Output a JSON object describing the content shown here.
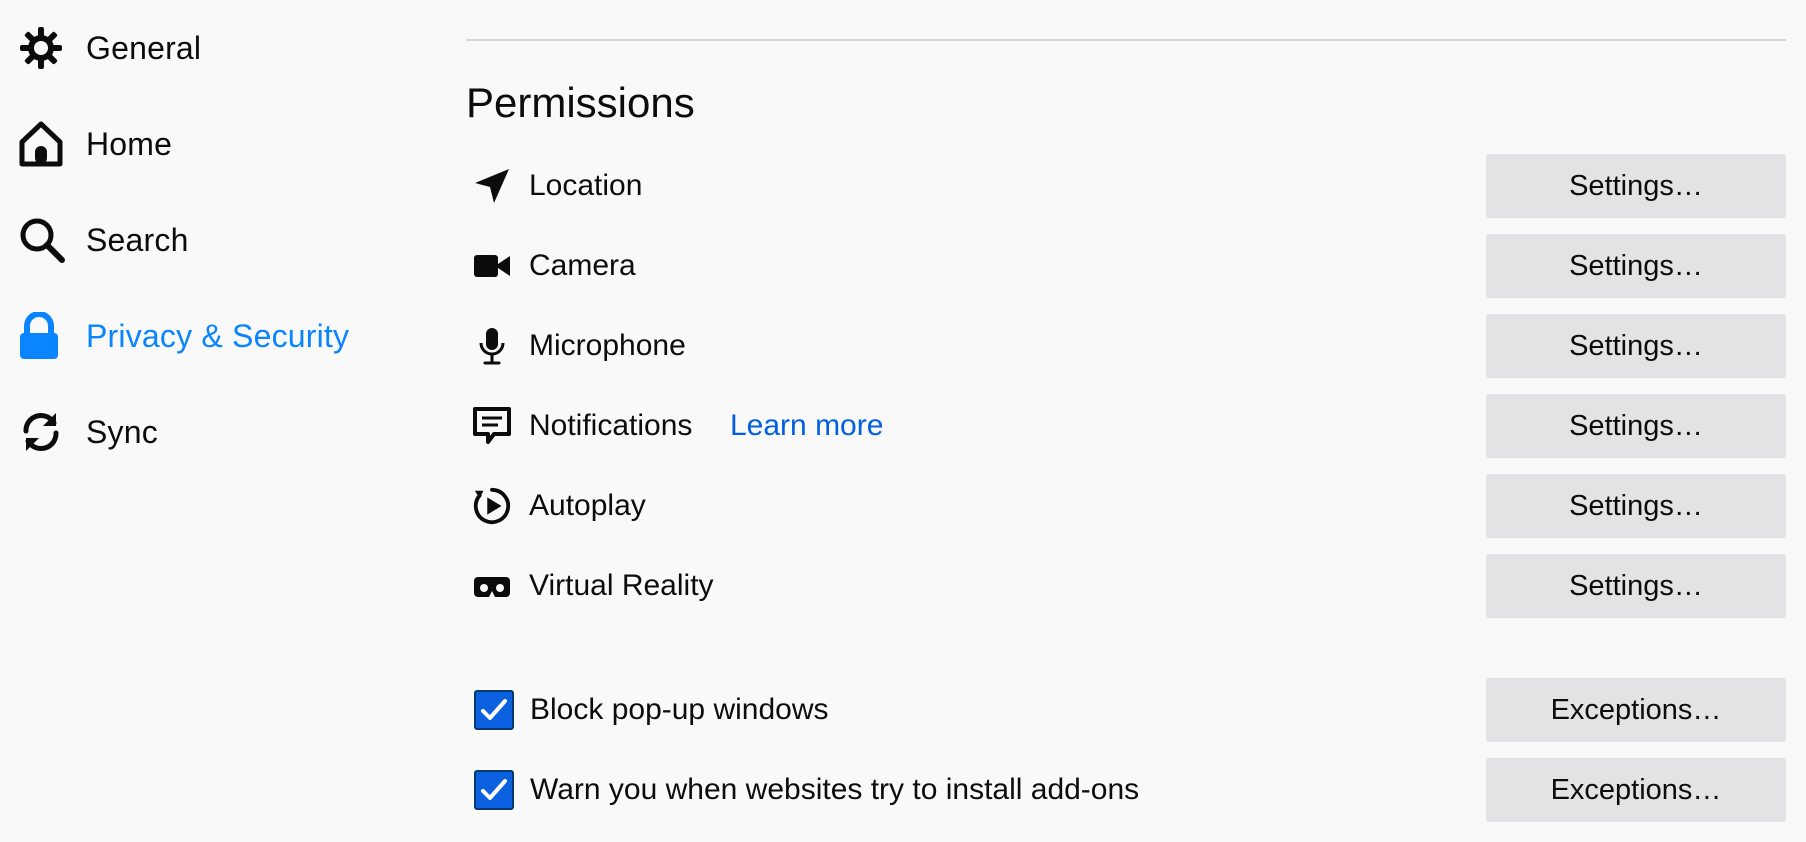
{
  "sidebar": {
    "items": [
      {
        "label": "General",
        "icon": "gear-icon"
      },
      {
        "label": "Home",
        "icon": "home-icon"
      },
      {
        "label": "Search",
        "icon": "search-icon"
      },
      {
        "label": "Privacy & Security",
        "icon": "lock-icon",
        "active": true
      },
      {
        "label": "Sync",
        "icon": "sync-icon"
      }
    ],
    "active_color": "#0a84ff"
  },
  "permissions": {
    "title": "Permissions",
    "rows": [
      {
        "label": "Location",
        "icon": "location-arrow-icon",
        "button": "Settings…"
      },
      {
        "label": "Camera",
        "icon": "camera-icon",
        "button": "Settings…"
      },
      {
        "label": "Microphone",
        "icon": "microphone-icon",
        "button": "Settings…"
      },
      {
        "label": "Notifications",
        "icon": "notification-icon",
        "link": "Learn more",
        "button": "Settings…"
      },
      {
        "label": "Autoplay",
        "icon": "autoplay-icon",
        "button": "Settings…"
      },
      {
        "label": "Virtual Reality",
        "icon": "vr-headset-icon",
        "button": "Settings…"
      }
    ],
    "checkboxes": [
      {
        "label": "Block pop-up windows",
        "checked": true,
        "button": "Exceptions…"
      },
      {
        "label": "Warn you when websites try to install add-ons",
        "checked": true,
        "button": "Exceptions…"
      }
    ]
  },
  "colors": {
    "link": "#0060df",
    "checkbox_fill": "#0a60df",
    "button_bg": "#e3e3e5",
    "page_bg": "#f9f9fa"
  }
}
